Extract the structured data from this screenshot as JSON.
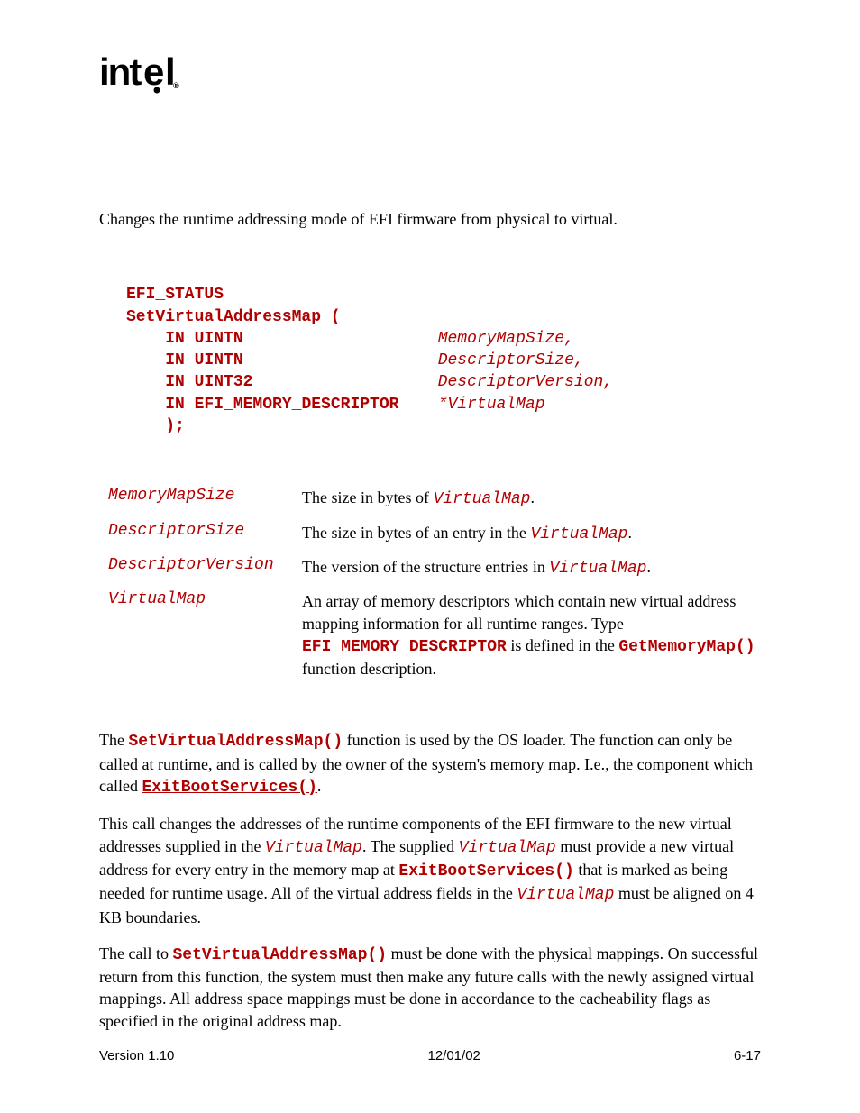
{
  "logo": "intel",
  "intro": "Changes the runtime addressing mode of EFI firmware from physical to virtual.",
  "prototype": {
    "l1": "EFI_STATUS",
    "l2": "SetVirtualAddressMap (",
    "l3a": "IN UINTN",
    "l3b": "MemoryMapSize,",
    "l4a": "IN UINTN",
    "l4b": "DescriptorSize,",
    "l5a": "IN UINT32",
    "l5b": "DescriptorVersion,",
    "l6a": "IN EFI_MEMORY_DESCRIPTOR",
    "l6b": "*VirtualMap",
    "l7": ");"
  },
  "params": {
    "p1name": "MemoryMapSize",
    "p1a": "The size in bytes of ",
    "p1b": "VirtualMap",
    "p1c": ".",
    "p2name": "DescriptorSize",
    "p2a": "The size in bytes of an entry in the ",
    "p2b": "VirtualMap",
    "p2c": ".",
    "p3name": "DescriptorVersion",
    "p3a": "The version of the structure entries in ",
    "p3b": "VirtualMap",
    "p3c": ".",
    "p4name": "VirtualMap",
    "p4a": "An array of memory descriptors which contain new virtual address mapping information for all runtime ranges.  Type ",
    "p4b": "EFI_MEMORY_DESCRIPTOR",
    "p4c": " is defined in the ",
    "p4d": "GetMemoryMap()",
    "p4e": " function description."
  },
  "desc1": {
    "a": "The ",
    "b": "SetVirtualAddressMap()",
    "c": " function is used by the OS loader.  The function can only be called at runtime, and is called by the owner of the system's memory map.  I.e., the component which called ",
    "d": "ExitBootServices()",
    "e": "."
  },
  "desc2": {
    "a": "This call changes the addresses of the runtime components of the EFI firmware to the new virtual addresses supplied in the ",
    "b": "VirtualMap",
    "c": ".  The supplied ",
    "d": "VirtualMap",
    "e": " must provide a new virtual address for every entry in the memory map at ",
    "f": "ExitBootServices()",
    "g": " that is marked as being needed for runtime usage.  All of the virtual address fields in the ",
    "h": "VirtualMap",
    "i": "  must be aligned on 4 KB boundaries."
  },
  "desc3": {
    "a": "The call to ",
    "b": "SetVirtualAddressMap()",
    "c": " must be done with the physical mappings.  On successful return from this function, the system must then make any future calls with the newly assigned virtual mappings.  All address space mappings must be done in accordance to the cacheability flags as specified in the original address map."
  },
  "footer": {
    "left": "Version 1.10",
    "center": "12/01/02",
    "right": "6-17"
  }
}
